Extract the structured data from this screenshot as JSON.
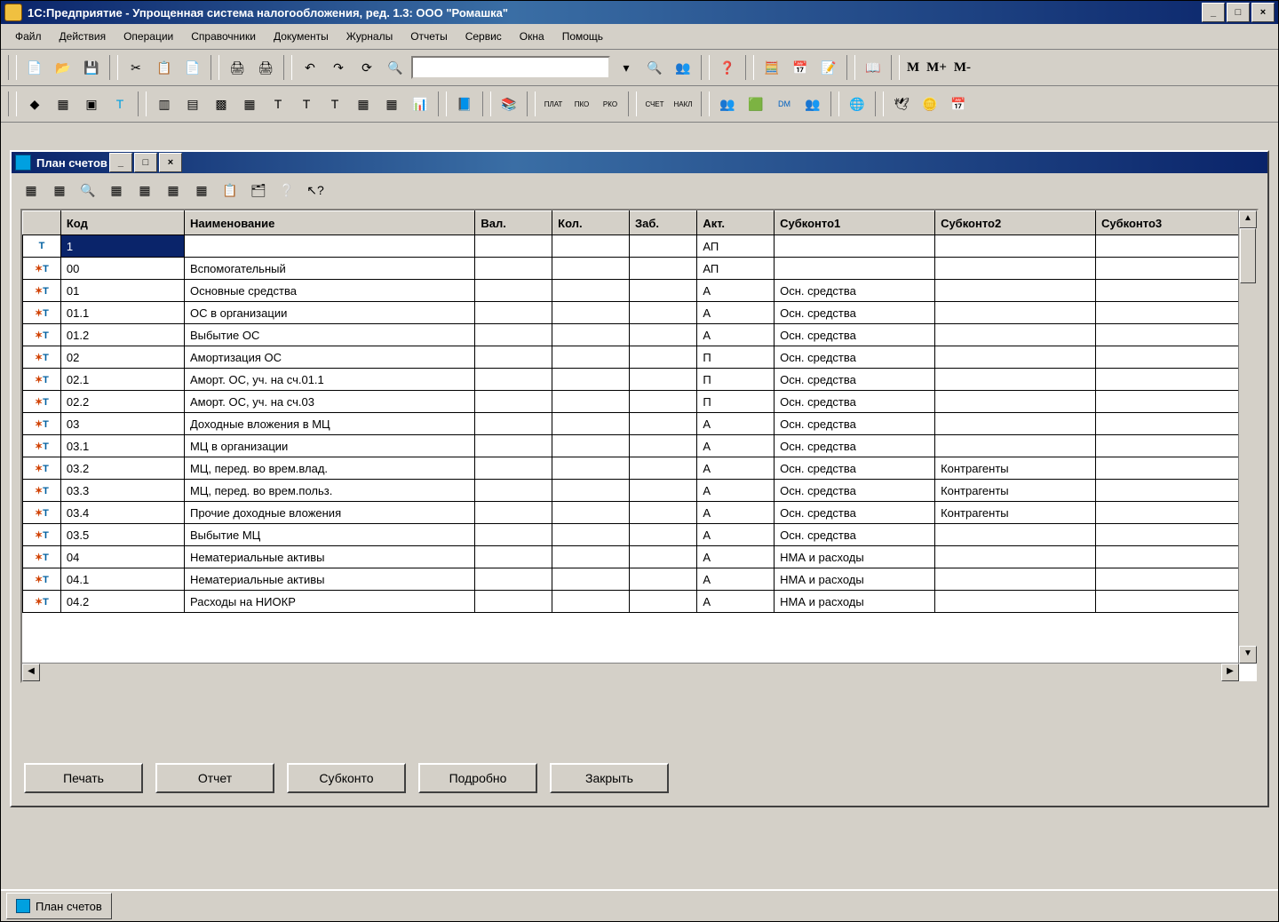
{
  "app_title": "1С:Предприятие - Упрощенная система налогообложения, ред. 1.3: ООО \"Ромашка\"",
  "menu": [
    "Файл",
    "Действия",
    "Операции",
    "Справочники",
    "Документы",
    "Журналы",
    "Отчеты",
    "Сервис",
    "Окна",
    "Помощь"
  ],
  "calc_buttons": [
    "M",
    "M+",
    "M-"
  ],
  "inner_window": {
    "title": "План счетов",
    "buttons": {
      "print": "Печать",
      "report": "Отчет",
      "subkonto": "Субконто",
      "detail": "Подробно",
      "close": "Закрыть"
    },
    "columns": [
      "",
      "Код",
      "Наименование",
      "Вал.",
      "Кол.",
      "Заб.",
      "Акт.",
      "Субконто1",
      "Субконто2",
      "Субконто3"
    ],
    "rows": [
      {
        "sel": true,
        "code": "1",
        "name": "",
        "val": "",
        "kol": "",
        "zab": "",
        "akt": "АП",
        "s1": "",
        "s2": "",
        "s3": ""
      },
      {
        "code": "00",
        "name": "Вспомогательный",
        "val": "",
        "kol": "",
        "zab": "",
        "akt": "АП",
        "s1": "",
        "s2": "",
        "s3": ""
      },
      {
        "code": "01",
        "name": "Основные средства",
        "val": "",
        "kol": "",
        "zab": "",
        "akt": "А",
        "s1": "Осн. средства",
        "s2": "",
        "s3": ""
      },
      {
        "code": "01.1",
        "name": "ОС в организации",
        "val": "",
        "kol": "",
        "zab": "",
        "akt": "А",
        "s1": "Осн. средства",
        "s2": "",
        "s3": ""
      },
      {
        "code": "01.2",
        "name": "Выбытие ОС",
        "val": "",
        "kol": "",
        "zab": "",
        "akt": "А",
        "s1": "Осн. средства",
        "s2": "",
        "s3": ""
      },
      {
        "code": "02",
        "name": "Амортизация ОС",
        "val": "",
        "kol": "",
        "zab": "",
        "akt": "П",
        "s1": "Осн. средства",
        "s2": "",
        "s3": ""
      },
      {
        "code": "02.1",
        "name": "Аморт. ОС, уч. на сч.01.1",
        "val": "",
        "kol": "",
        "zab": "",
        "akt": "П",
        "s1": "Осн. средства",
        "s2": "",
        "s3": ""
      },
      {
        "code": "02.2",
        "name": "Аморт. ОС, уч. на сч.03",
        "val": "",
        "kol": "",
        "zab": "",
        "akt": "П",
        "s1": "Осн. средства",
        "s2": "",
        "s3": ""
      },
      {
        "code": "03",
        "name": "Доходные вложения в МЦ",
        "val": "",
        "kol": "",
        "zab": "",
        "akt": "А",
        "s1": "Осн. средства",
        "s2": "",
        "s3": ""
      },
      {
        "code": "03.1",
        "name": "МЦ в организации",
        "val": "",
        "kol": "",
        "zab": "",
        "akt": "А",
        "s1": "Осн. средства",
        "s2": "",
        "s3": ""
      },
      {
        "code": "03.2",
        "name": "МЦ, перед. во врем.влад.",
        "val": "",
        "kol": "",
        "zab": "",
        "akt": "А",
        "s1": "Осн. средства",
        "s2": "Контрагенты",
        "s3": ""
      },
      {
        "code": "03.3",
        "name": "МЦ, перед. во врем.польз.",
        "val": "",
        "kol": "",
        "zab": "",
        "akt": "А",
        "s1": "Осн. средства",
        "s2": "Контрагенты",
        "s3": ""
      },
      {
        "code": "03.4",
        "name": "Прочие доходные вложения",
        "val": "",
        "kol": "",
        "zab": "",
        "akt": "А",
        "s1": "Осн. средства",
        "s2": "Контрагенты",
        "s3": ""
      },
      {
        "code": "03.5",
        "name": "Выбытие МЦ",
        "val": "",
        "kol": "",
        "zab": "",
        "akt": "А",
        "s1": "Осн. средства",
        "s2": "",
        "s3": ""
      },
      {
        "code": "04",
        "name": "Нематериальные активы",
        "val": "",
        "kol": "",
        "zab": "",
        "akt": "А",
        "s1": "НМА и расходы",
        "s2": "",
        "s3": ""
      },
      {
        "code": "04.1",
        "name": "Нематериальные активы",
        "val": "",
        "kol": "",
        "zab": "",
        "akt": "А",
        "s1": "НМА и расходы",
        "s2": "",
        "s3": ""
      },
      {
        "code": "04.2",
        "name": "Расходы на НИОКР",
        "val": "",
        "kol": "",
        "zab": "",
        "akt": "А",
        "s1": "НМА и расходы",
        "s2": "",
        "s3": ""
      }
    ]
  },
  "taskbar_item": "План счетов"
}
